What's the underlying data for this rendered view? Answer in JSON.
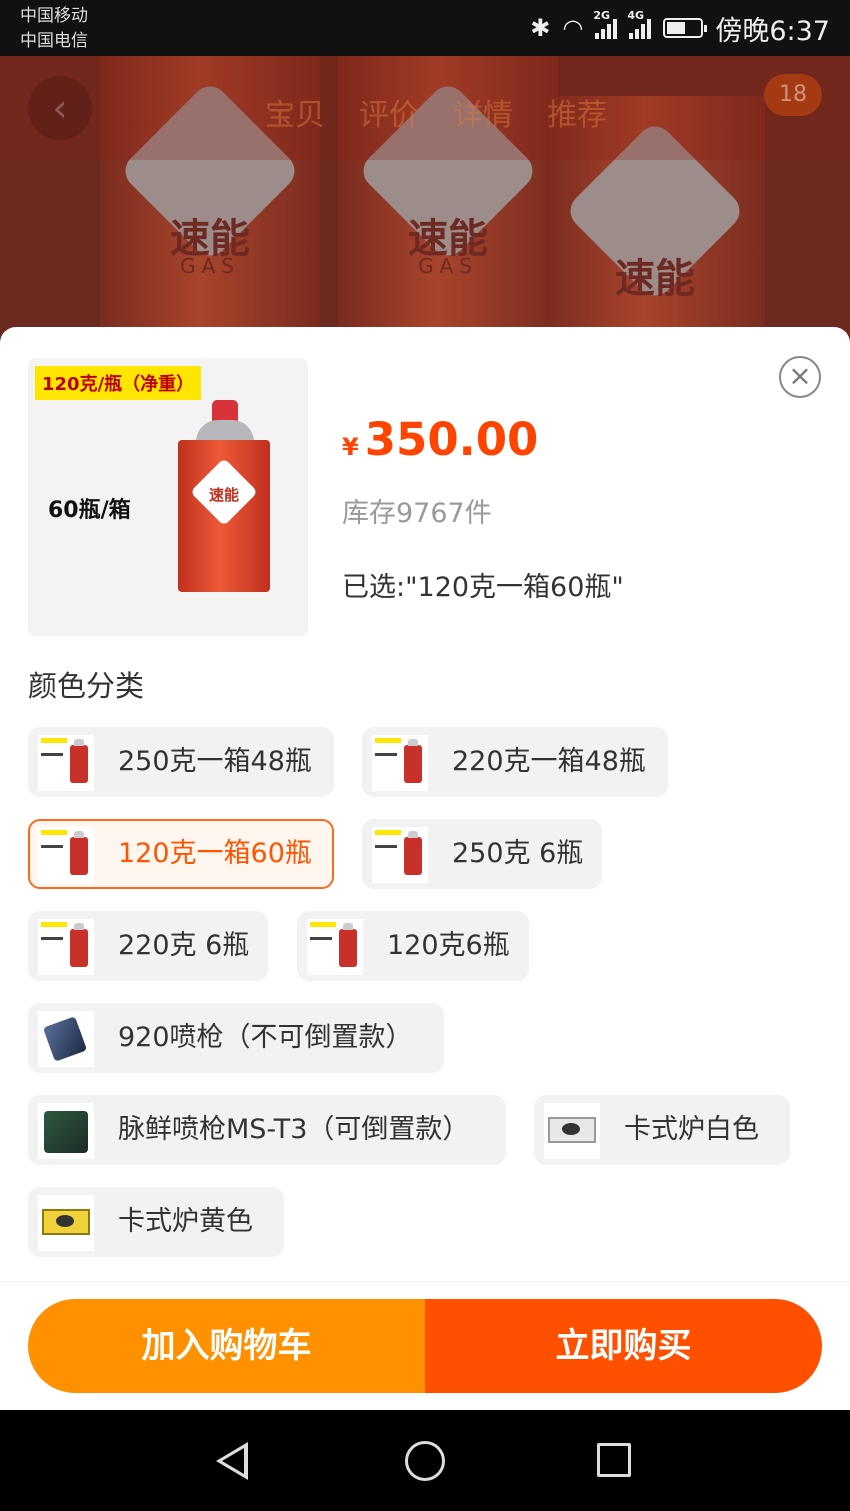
{
  "status_bar": {
    "carrier_1": "中国移动",
    "carrier_2": "中国电信",
    "network_1": "2G",
    "network_2": "4G",
    "time": "傍晚6:37"
  },
  "background": {
    "brand_text": "速能",
    "gas_text": "GAS",
    "tabs": [
      "宝贝",
      "评价",
      "详情",
      "推荐"
    ],
    "cart_badge": "18"
  },
  "sku_panel": {
    "thumb_tag": "120克/瓶（净重）",
    "thumb_count": "60瓶/箱",
    "thumb_brand": "速能",
    "currency": "¥",
    "price": "350.00",
    "stock": "库存9767件",
    "selected": "已选:\"120克一箱60瓶\"",
    "close_symbol": "×",
    "section_title": "颜色分类",
    "options": [
      {
        "label": "250克一箱48瓶",
        "icon": "gas-can-thumbnail",
        "selected": false
      },
      {
        "label": "220克一箱48瓶",
        "icon": "gas-can-thumbnail",
        "selected": false
      },
      {
        "label": "120克一箱60瓶",
        "icon": "gas-can-thumbnail",
        "selected": true
      },
      {
        "label": "250克 6瓶",
        "icon": "gas-can-thumbnail",
        "selected": false
      },
      {
        "label": "220克 6瓶",
        "icon": "gas-can-thumbnail",
        "selected": false
      },
      {
        "label": "120克6瓶",
        "icon": "gas-can-thumbnail",
        "selected": false
      },
      {
        "label": "920喷枪（不可倒置款）",
        "icon": "torch-thumbnail",
        "selected": false
      },
      {
        "label": "脉鲜喷枪MS-T3（可倒置款）",
        "icon": "torch-thumbnail",
        "selected": false
      },
      {
        "label": "卡式炉白色",
        "icon": "stove-thumbnail",
        "selected": false
      },
      {
        "label": "卡式炉黄色",
        "icon": "stove-thumbnail",
        "selected": false
      }
    ]
  },
  "actions": {
    "add_to_cart": "加入购物车",
    "buy_now": "立即购买"
  },
  "colors": {
    "price": "#ff4400",
    "cart_button": "#ff9000",
    "buy_button": "#ff5000",
    "selected_border": "#ff6a1a"
  }
}
